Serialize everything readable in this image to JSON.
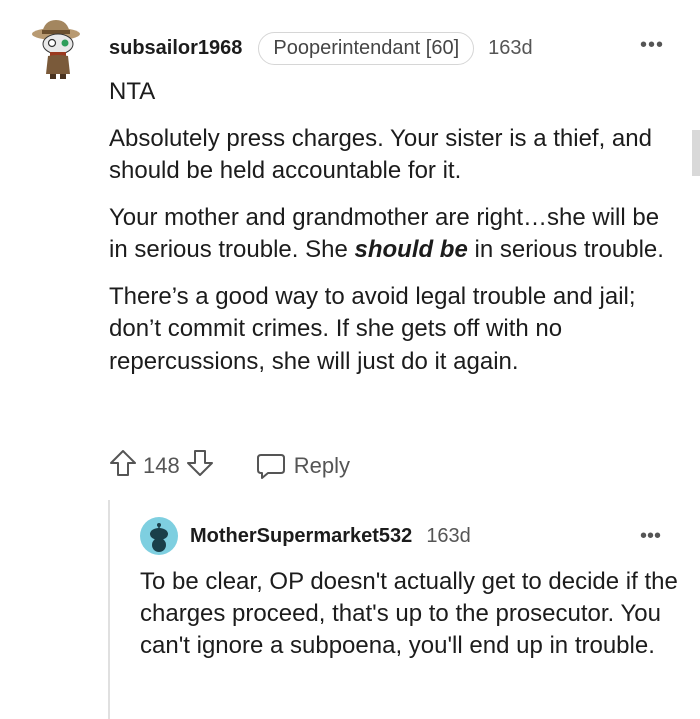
{
  "comment": {
    "username": "subsailor1968",
    "flair": "Pooperintendant [60]",
    "age": "163d",
    "more": "•••",
    "paragraphs": {
      "p1": "NTA",
      "p2": "Absolutely press charges. Your sister is a thief, and should be held accountable for it.",
      "p3_start": "Your mother and grandmother are right…she will be in serious trouble. She ",
      "p3_emphasis": "should be",
      "p3_end": " in serious trouble.",
      "p4": "There’s a good way to avoid legal trouble and jail; don’t commit crimes. If she gets off with no repercussions, she will just do it again."
    },
    "vote_count": "148",
    "reply_label": "Reply"
  },
  "reply": {
    "username": "MotherSupermarket532",
    "age": "163d",
    "more": "•••",
    "text": "To be clear, OP doesn't actually get to decide if the charges proceed, that's up to the prosecutor. You can't ignore a subpoena, you'll end up in trouble."
  },
  "icons": {
    "avatar1": "cowboy-snoo-avatar-icon",
    "avatar2": "snoo-avatar-icon",
    "upvote": "upvote-arrow-icon",
    "downvote": "downvote-arrow-icon",
    "reply": "speech-bubble-icon"
  },
  "colors": {
    "text": "#1c1c1c",
    "meta": "#555555",
    "avatar2_bg": "#7ecfe0"
  }
}
